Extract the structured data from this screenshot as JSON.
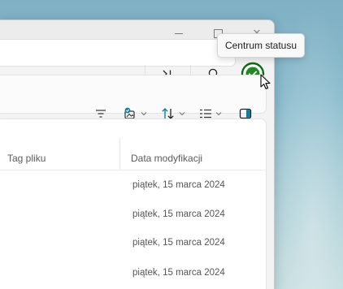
{
  "tooltip": {
    "text": "Centrum statusu"
  },
  "window_controls": {
    "close_glyph": "✕"
  },
  "address_bar": {
    "buttons": [
      {
        "name": "expand-path-icon",
        "glyph": ">|"
      },
      {
        "name": "search-icon",
        "glyph": "search"
      }
    ]
  },
  "status_button": {
    "icon": "check-circle-icon",
    "color": "#1f8a1f",
    "ring_color": "#0a6b12"
  },
  "command_bar": {
    "items": [
      {
        "name": "filter-icon"
      },
      {
        "name": "file-type-icon",
        "has_dropdown": true
      },
      {
        "name": "sort-icon",
        "has_dropdown": true
      },
      {
        "name": "view-icon",
        "has_dropdown": true
      },
      {
        "name": "details-pane-icon"
      }
    ],
    "accent": "#0f7fa0"
  },
  "file_list": {
    "columns": [
      "Tag pliku",
      "Data modyfikacji"
    ],
    "rows": [
      {
        "date": "piątek, 15 marca 2024"
      },
      {
        "date": "piątek, 15 marca 2024"
      },
      {
        "date": "piątek, 15 marca 2024"
      },
      {
        "date": "piątek, 15 marca 2024"
      }
    ]
  }
}
